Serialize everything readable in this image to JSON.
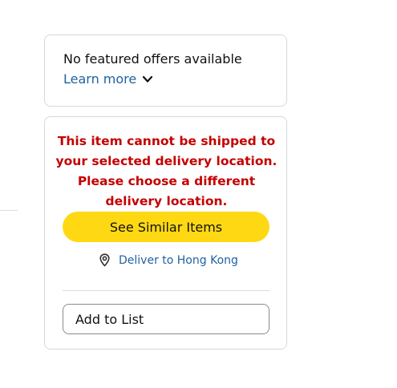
{
  "offers": {
    "text": "No featured offers available",
    "learn_more": "Learn more",
    "learn_more_icon": "chevron-down-icon"
  },
  "buy_box": {
    "error_message": "This item cannot be shipped to your selected delivery location. Please choose a different delivery location.",
    "similar_button": "See Similar Items",
    "deliver_icon": "location-pin-icon",
    "deliver_text": "Deliver to Hong Kong",
    "add_to_list": "Add to List"
  },
  "colors": {
    "error": "#c40000",
    "link": "#2162a1",
    "primary_button": "#ffd814",
    "border": "#d5d9d9"
  }
}
